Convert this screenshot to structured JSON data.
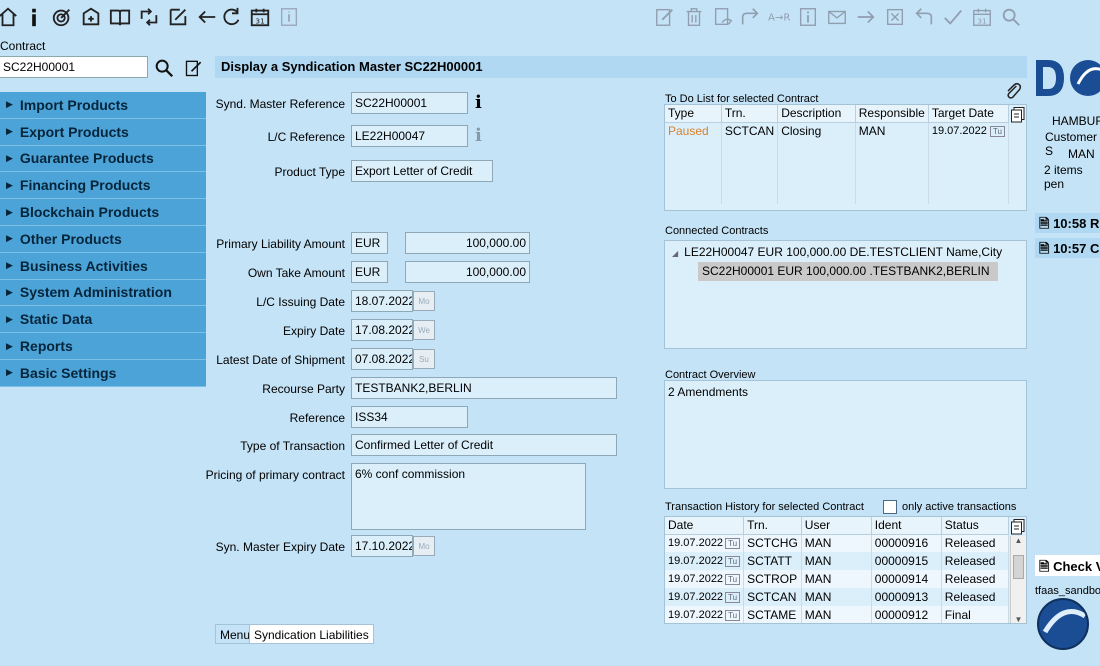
{
  "toolbar_left": [
    {
      "name": "home-icon"
    },
    {
      "name": "info-icon"
    },
    {
      "name": "target-icon"
    },
    {
      "name": "import-icon"
    },
    {
      "name": "book-icon"
    },
    {
      "name": "cycle-icon"
    },
    {
      "name": "edit-icon"
    },
    {
      "name": "back-arrow-icon"
    },
    {
      "name": "refresh-icon"
    },
    {
      "name": "calendar-icon"
    },
    {
      "name": "info-box-icon"
    }
  ],
  "toolbar_right": [
    {
      "name": "edit-doc-icon"
    },
    {
      "name": "trash-icon"
    },
    {
      "name": "copy-doc-icon"
    },
    {
      "name": "redo-icon"
    },
    {
      "name": "transfer-icon"
    },
    {
      "name": "info-doc-icon"
    },
    {
      "name": "mail-icon"
    },
    {
      "name": "forward-arrow-icon"
    },
    {
      "name": "close-box-icon"
    },
    {
      "name": "undo-icon"
    },
    {
      "name": "check-icon"
    },
    {
      "name": "calendar-31-icon"
    },
    {
      "name": "search-icon"
    }
  ],
  "contract": {
    "label": "Contract",
    "value": "SC22H00001"
  },
  "nav": [
    "Import Products",
    "Export Products",
    "Guarantee Products",
    "Financing Products",
    "Blockchain Products",
    "Other Products",
    "Business Activities",
    "System Administration",
    "Static Data",
    "Reports",
    "Basic Settings"
  ],
  "header_title": "Display a Syndication Master SC22H00001",
  "form": {
    "synd_ref": {
      "label": "Synd. Master Reference",
      "value": "SC22H00001"
    },
    "lc_ref": {
      "label": "L/C Reference",
      "value": "LE22H00047"
    },
    "product_type": {
      "label": "Product Type",
      "value": "Export Letter of Credit"
    },
    "primary_liab": {
      "label": "Primary Liability Amount",
      "currency": "EUR",
      "amount": "100,000.00"
    },
    "own_take": {
      "label": "Own Take Amount",
      "currency": "EUR",
      "amount": "100,000.00"
    },
    "lc_issuing_date": {
      "label": "L/C Issuing Date",
      "value": "18.07.2022",
      "day": "Mo"
    },
    "expiry_date": {
      "label": "Expiry Date",
      "value": "17.08.2022",
      "day": "We"
    },
    "latest_ship": {
      "label": "Latest Date of Shipment",
      "value": "07.08.2022",
      "day": "Su"
    },
    "recourse_party": {
      "label": "Recourse Party",
      "value": "TESTBANK2,BERLIN"
    },
    "reference": {
      "label": "Reference",
      "value": "ISS34"
    },
    "type_tx": {
      "label": "Type of Transaction",
      "value": "Confirmed Letter of Credit"
    },
    "pricing": {
      "label": "Pricing of primary contract",
      "value": "6% conf commission"
    },
    "syn_expiry": {
      "label": "Syn. Master Expiry Date",
      "value": "17.10.2022",
      "day": "Mo"
    }
  },
  "todo": {
    "title": "To Do List for selected Contract",
    "headers": [
      "Type",
      "Trn.",
      "Description",
      "Responsible",
      "Target Date"
    ],
    "rows": [
      {
        "type": "Paused",
        "trn": "SCTCAN",
        "desc": "Closing",
        "resp": "MAN",
        "date": "19.07.2022",
        "day": "Tu"
      }
    ]
  },
  "connected": {
    "title": "Connected Contracts",
    "parent": "LE22H00047 EUR 100,000.00 DE.TESTCLIENT Name,City",
    "child": "SC22H00001 EUR 100,000.00 .TESTBANK2,BERLIN"
  },
  "overview": {
    "title": "Contract Overview",
    "text": "2 Amendments"
  },
  "history": {
    "title": "Transaction History for selected Contract",
    "checkbox_label": "only active transactions",
    "headers": [
      "Date",
      "Trn.",
      "User",
      "Ident",
      "Status"
    ],
    "rows": [
      {
        "date": "19.07.2022",
        "day": "Tu",
        "trn": "SCTCHG",
        "user": "MAN",
        "ident": "00000916",
        "status": "Released"
      },
      {
        "date": "19.07.2022",
        "day": "Tu",
        "trn": "SCTATT",
        "user": "MAN",
        "ident": "00000915",
        "status": "Released"
      },
      {
        "date": "19.07.2022",
        "day": "Tu",
        "trn": "SCTROP",
        "user": "MAN",
        "ident": "00000914",
        "status": "Released"
      },
      {
        "date": "19.07.2022",
        "day": "Tu",
        "trn": "SCTCAN",
        "user": "MAN",
        "ident": "00000913",
        "status": "Released"
      },
      {
        "date": "19.07.2022",
        "day": "Tu",
        "trn": "SCTAME",
        "user": "MAN",
        "ident": "00000912",
        "status": "Final"
      }
    ]
  },
  "tabs": [
    "Menu",
    "Syndication Liabilities"
  ],
  "right_panel": {
    "city": "HAMBUR",
    "customer": "Customer S",
    "user": "MAN",
    "pending": "2 items pen",
    "msg1": "10:58 R",
    "msg2": "10:57 C",
    "check": "Check V",
    "sandbox": "tfaas_sandbo"
  },
  "colors": {
    "nav_bg": "#4ba3d7",
    "page_bg": "#c5e3f6",
    "paused": "#d9822b",
    "logo_blue": "#1a4d94"
  }
}
